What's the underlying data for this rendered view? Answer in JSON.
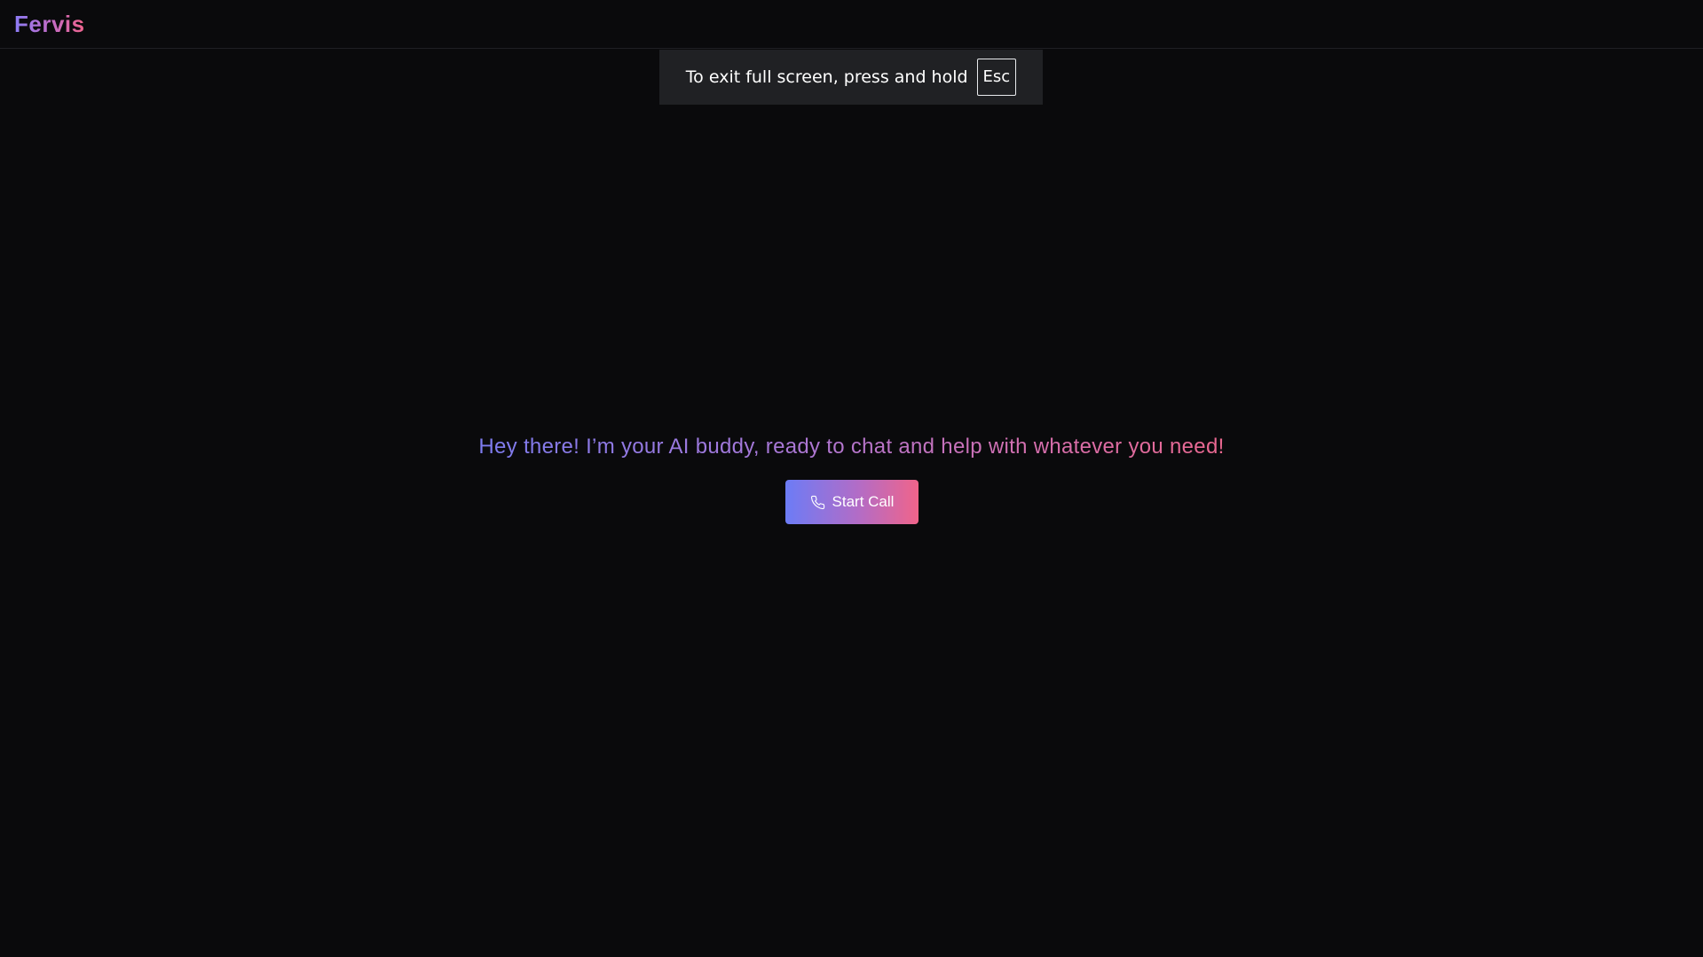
{
  "brand": {
    "name": "Fervis"
  },
  "fullscreen_notice": {
    "text": "To exit full screen, press and hold",
    "key": "Esc"
  },
  "main": {
    "greeting": "Hey there! I’m your AI buddy, ready to chat and help with whatever you need!",
    "start_call_label": "Start Call",
    "start_call_icon": "phone-icon"
  },
  "colors": {
    "background": "#0a0a0c",
    "gradient_start": "#7d7cf0",
    "gradient_end": "#f0648a",
    "toast_background": "#202124"
  }
}
